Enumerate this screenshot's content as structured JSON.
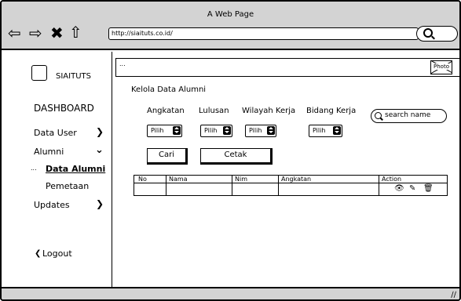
{
  "browser": {
    "title": "A Web Page",
    "url": "http://siaituts.co.id/"
  },
  "sidebar": {
    "logo_text": "SIAITUTS",
    "items": [
      {
        "label": "DASHBOARD"
      },
      {
        "label": "Data User"
      },
      {
        "label": "Alumni"
      },
      {
        "label": "Data Alumni"
      },
      {
        "label": "Pemetaan"
      },
      {
        "label": "Updates"
      },
      {
        "label": "Logout"
      }
    ]
  },
  "topbar": {
    "placeholder_text": "...",
    "photo_label": "Photo"
  },
  "main": {
    "title": "Kelola Data Alumni",
    "filters": [
      {
        "label": "Angkatan",
        "value": "Pilih"
      },
      {
        "label": "Lulusan",
        "value": "Pilih"
      },
      {
        "label": "Wilayah Kerja",
        "value": "Pilih"
      },
      {
        "label": "Bidang Kerja",
        "value": "Pilih"
      }
    ],
    "search_placeholder": "search name",
    "buttons": {
      "cari": "Cari",
      "cetak": "Cetak"
    },
    "table": {
      "headers": [
        "No",
        "Nama",
        "Nim",
        "Angkatan",
        "Action"
      ]
    }
  },
  "icons": {
    "back": "back-arrow-icon",
    "forward": "forward-arrow-icon",
    "stop": "close-icon",
    "home": "home-icon",
    "view": "eye-icon",
    "edit": "edit-icon",
    "delete": "trash-icon"
  }
}
